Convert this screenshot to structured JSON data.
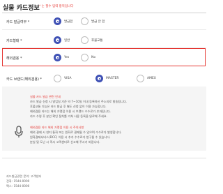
{
  "section": {
    "title": "실물 카드정보",
    "note": "* 는 필수 입력 항목입니다"
  },
  "rows": [
    {
      "label": "카드 발급여부 *",
      "options": [
        "발급함",
        "발급 안 함"
      ],
      "selected": 0
    },
    {
      "label": "카드형태 *",
      "options": [
        "일반",
        "후불교통"
      ],
      "selected": 0
    },
    {
      "label": "해외겸용 *",
      "options": [
        "Yes",
        "No"
      ],
      "selected": 0
    },
    {
      "label": "카드 브랜드(해외겸용) *",
      "options": [
        "VISA",
        "MASTER",
        "AMEX"
      ],
      "selected": 1
    }
  ],
  "notice": {
    "icon": "microphone-icon",
    "lines": [
      {
        "text": "실물 카드 발급 관련 안내",
        "style": "red"
      },
      {
        "text": "카드 발급 신청 시 영업일 기준 약 7~10일 이내 등록하신 주소지로 발송됩니다.",
        "style": "normal"
      },
      {
        "text": "후불교통 기능은 카드 발급 후 별도 신청 없이 이용 가능합니다.",
        "style": "normal"
      },
      {
        "text": "해외겸용 카드는 해외 가맹점 이용 시 브랜드 수수료가 부과됩니다.",
        "style": "normal"
      },
      {
        "text": "카드 수령 후 본인 확인 절차를 거쳐 사용 등록을 완료해 주세요.",
        "style": "normal"
      },
      {
        "text": "",
        "style": "normal"
      },
      {
        "text": "해외겸용 카드 해외 가맹점 이용 시 주의사항",
        "style": "red"
      },
      {
        "text": "해외 결제 시 현지 통화 또는 원화로 결제될 수 있으며 수수료가 발생합니다.",
        "style": "normal"
      },
      {
        "text": "원화결제서비스(DCC) 이용 시 추가 수수료가 청구될 수 있습니다.",
        "style": "normal"
      },
      {
        "text": "분실 및 도난 시 즉시 고객센터로 신고해 주시기 바랍니다.",
        "style": "normal"
      }
    ]
  },
  "footer": [
    "카드발급관련 문의: 고객센터",
    "전화: 1544-0000",
    "팩스: 1544-0000"
  ]
}
